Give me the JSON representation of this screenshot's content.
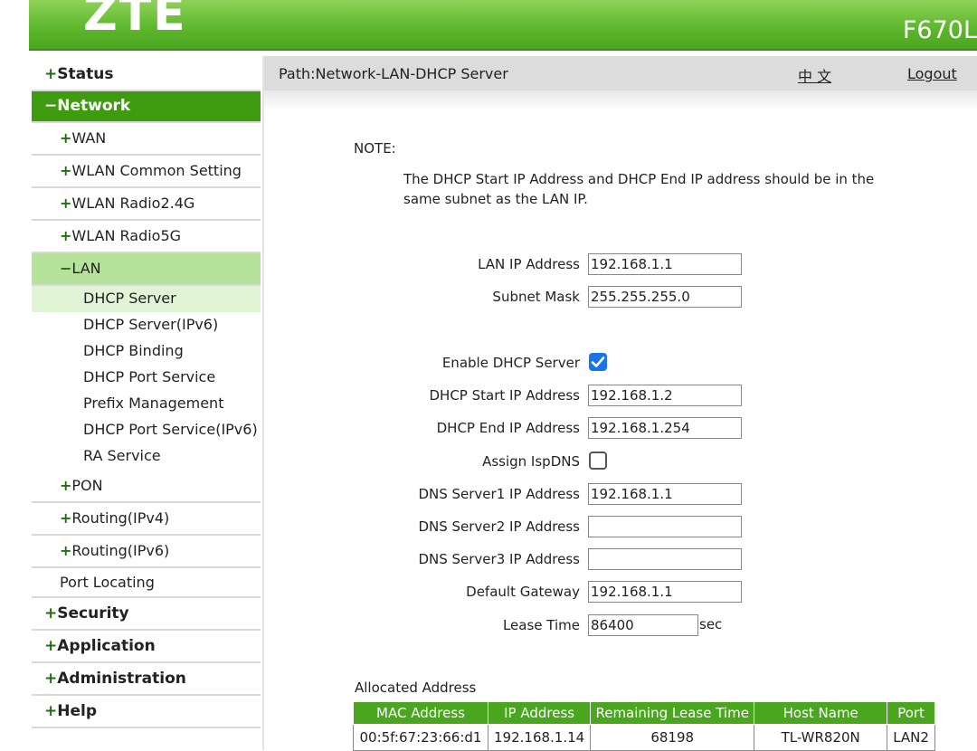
{
  "header": {
    "logo": "ZTE",
    "model": "F670L"
  },
  "sidebar": {
    "items": [
      {
        "pm": "+",
        "label": "Status",
        "level": 1
      },
      {
        "pm": "−",
        "label": "Network",
        "level": 1,
        "active": true
      },
      {
        "pm": "+",
        "label": "WAN",
        "level": 2
      },
      {
        "pm": "+",
        "label": "WLAN Common Setting",
        "level": 2
      },
      {
        "pm": "+",
        "label": "WLAN Radio2.4G",
        "level": 2
      },
      {
        "pm": "+",
        "label": "WLAN Radio5G",
        "level": 2
      },
      {
        "pm": "−",
        "label": "LAN",
        "level": 2,
        "active": true
      },
      {
        "label": "DHCP Server",
        "level": 3,
        "active": true
      },
      {
        "label": "DHCP Server(IPv6)",
        "level": 3
      },
      {
        "label": "DHCP Binding",
        "level": 3
      },
      {
        "label": "DHCP Port Service",
        "level": 3
      },
      {
        "label": "Prefix Management",
        "level": 3
      },
      {
        "label": "DHCP Port Service(IPv6)",
        "level": 3
      },
      {
        "label": "RA Service",
        "level": 3
      },
      {
        "pm": "+",
        "label": "PON",
        "level": 2
      },
      {
        "pm": "+",
        "label": "Routing(IPv4)",
        "level": 2
      },
      {
        "pm": "+",
        "label": "Routing(IPv6)",
        "level": 2
      },
      {
        "label": "Port Locating",
        "level": 2
      },
      {
        "pm": "+",
        "label": "Security",
        "level": 1
      },
      {
        "pm": "+",
        "label": "Application",
        "level": 1
      },
      {
        "pm": "+",
        "label": "Administration",
        "level": 1
      },
      {
        "pm": "+",
        "label": "Help",
        "level": 1
      }
    ]
  },
  "pathbar": {
    "path": "Path:Network-LAN-DHCP Server",
    "lang": "中 文",
    "logout": "Logout"
  },
  "note": {
    "title": "NOTE:",
    "text": "The DHCP Start IP Address and DHCP End IP address should be in the same subnet as the LAN IP."
  },
  "form": {
    "lan_ip": {
      "label": "LAN IP Address",
      "value": "192.168.1.1"
    },
    "subnet_mask": {
      "label": "Subnet Mask",
      "value": "255.255.255.0"
    },
    "enable_dhcp": {
      "label": "Enable DHCP Server",
      "checked": true
    },
    "start_ip": {
      "label": "DHCP Start IP Address",
      "value": "192.168.1.2"
    },
    "end_ip": {
      "label": "DHCP End IP Address",
      "value": "192.168.1.254"
    },
    "assign_isp_dns": {
      "label": "Assign IspDNS",
      "checked": false
    },
    "dns1": {
      "label": "DNS Server1 IP Address",
      "value": "192.168.1.1"
    },
    "dns2": {
      "label": "DNS Server2 IP Address",
      "value": ""
    },
    "dns3": {
      "label": "DNS Server3 IP Address",
      "value": ""
    },
    "gateway": {
      "label": "Default Gateway",
      "value": "192.168.1.1"
    },
    "lease": {
      "label": "Lease Time",
      "value": "86400",
      "unit": "sec"
    }
  },
  "allocated": {
    "title": "Allocated Address",
    "headers": [
      "MAC Address",
      "IP Address",
      "Remaining Lease Time",
      "Host Name",
      "Port"
    ],
    "rows": [
      [
        "00:5f:67:23:66:d1",
        "192.168.1.14",
        "68198",
        "TL-WR820N",
        "LAN2"
      ]
    ]
  },
  "colors": {
    "brand_green": "#4aa61f",
    "active_green": "#3e9b0f",
    "checkbox_blue": "#1a73e8"
  }
}
